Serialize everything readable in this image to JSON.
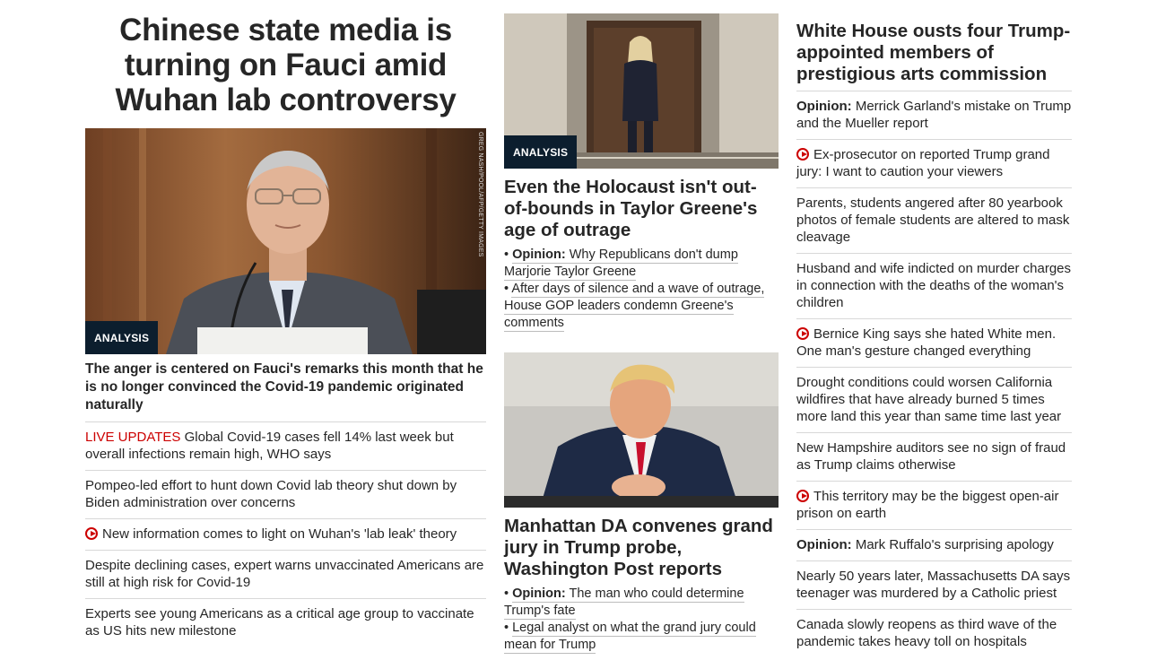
{
  "col1": {
    "headline": "Chinese state media is turning on Fauci amid Wuhan lab controversy",
    "photo_tag": "ANALYSIS",
    "photo_credit": "GREG NASH/POOL/AFP/GETTY IMAGES",
    "subhead": "The anger is centered on Fauci's remarks this month that he is no longer convinced the Covid-19 pandemic originated naturally",
    "items": [
      {
        "prefix": "LIVE UPDATES",
        "text": "Global Covid-19 cases fell 14% last week but overall infections remain high, WHO says"
      },
      {
        "text": "Pompeo-led effort to hunt down Covid lab theory shut down by Biden administration over concerns"
      },
      {
        "text": "New information comes to light on Wuhan's 'lab leak' theory"
      },
      {
        "text": "Despite declining cases, expert warns unvaccinated Americans are still at high risk for Covid-19"
      },
      {
        "text": "Experts see young Americans as a critical age group to vaccinate as US hits new milestone"
      }
    ]
  },
  "col2": {
    "story1": {
      "photo_tag": "ANALYSIS",
      "headline": "Even the Holocaust isn't out-of-bounds in Taylor Greene's age of outrage",
      "bullet1_bold": "Opinion:",
      "bullet1_text": "Why Republicans don't dump Marjorie Taylor Greene",
      "bullet2_text": "After days of silence and a wave of outrage, House GOP leaders condemn Greene's comments"
    },
    "story2": {
      "headline": "Manhattan DA convenes grand jury in Trump probe, Washington Post reports",
      "bullet1_bold": "Opinion:",
      "bullet1_text": "The man who could determine Trump's fate",
      "bullet2_text": "Legal analyst on what the grand jury could mean for Trump"
    }
  },
  "col3": {
    "headline": "White House ousts four Trump-appointed members of prestigious arts commission",
    "items": [
      {
        "bold": "Opinion:",
        "text": "Merrick Garland's mistake on Trump and the Mueller report"
      },
      {
        "text": "Ex-prosecutor on reported Trump grand jury: I want to caution your viewers"
      },
      {
        "text": "Parents, students angered after 80 yearbook photos of female students are altered to mask cleavage"
      },
      {
        "text": "Husband and wife indicted on murder charges in connection with the deaths of the woman's children"
      },
      {
        "text": "Bernice King says she hated White men. One man's gesture changed everything"
      },
      {
        "text": "Drought conditions could worsen California wildfires that have already burned 5 times more land this year than same time last year"
      },
      {
        "text": "New Hampshire auditors see no sign of fraud as Trump claims otherwise"
      },
      {
        "text": "This territory may be the biggest open-air prison on earth"
      },
      {
        "bold": "Opinion:",
        "text": "Mark Ruffalo's surprising apology"
      },
      {
        "text": "Nearly 50 years later, Massachusetts DA says teenager was murdered by a Catholic priest"
      },
      {
        "text": "Canada slowly reopens as third wave of the pandemic takes heavy toll on hospitals"
      }
    ]
  },
  "icons": {
    "video": "play-circle-icon"
  },
  "colors": {
    "live": "#cc0000",
    "tag_bg": "#0c1e2e",
    "text": "#262626",
    "divider": "#d8d8d8"
  }
}
